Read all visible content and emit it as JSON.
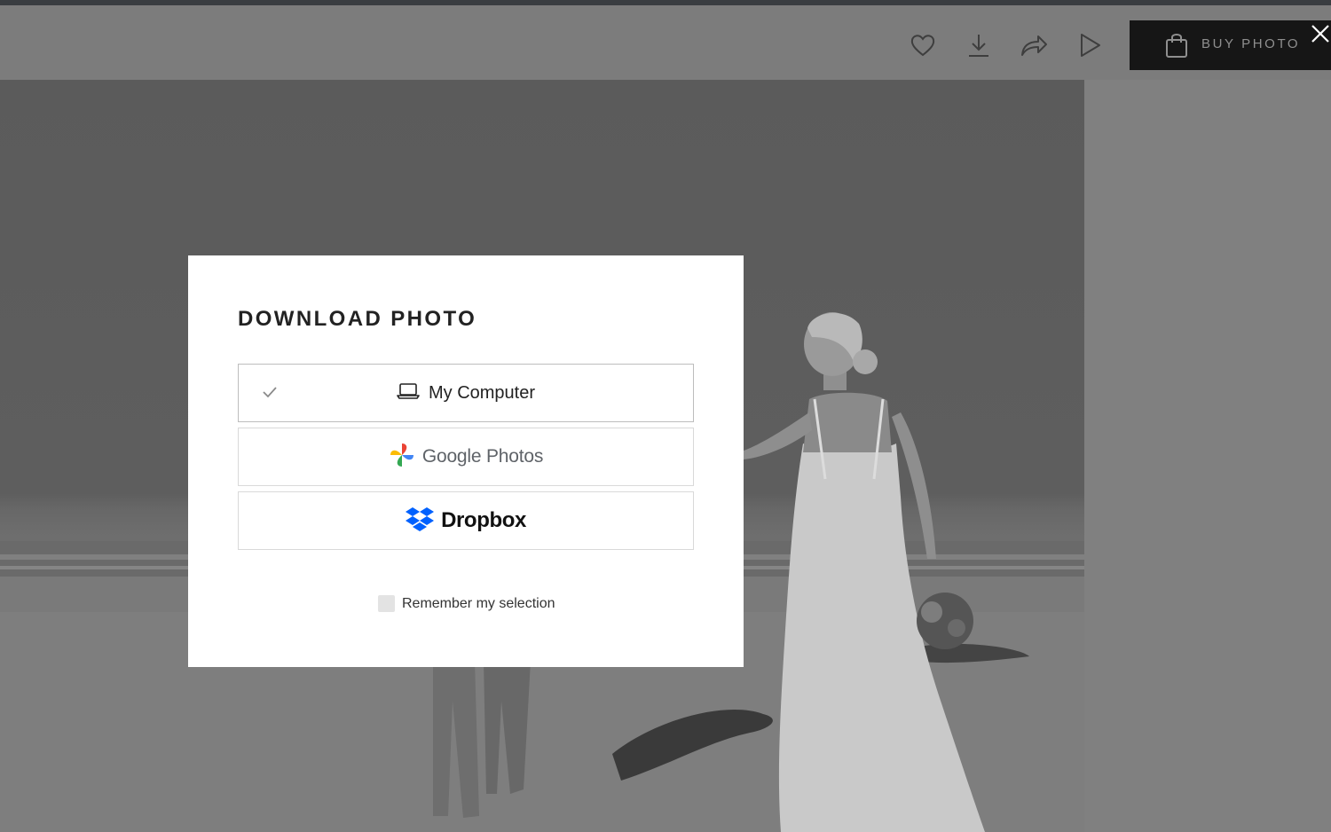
{
  "toolbar": {
    "icons": [
      "heart-icon",
      "download-icon",
      "share-icon",
      "play-icon"
    ],
    "buy_label": "BUY PHOTO",
    "close_icon": "close-icon"
  },
  "photo": {
    "description_icon": "wedding-beach-photo"
  },
  "modal": {
    "title": "DOWNLOAD PHOTO",
    "options": [
      {
        "label": "My Computer",
        "icon": "laptop-icon",
        "selected": true
      },
      {
        "label": "Google Photos",
        "icon": "google-photos-icon",
        "selected": false
      },
      {
        "label": "Dropbox",
        "icon": "dropbox-icon",
        "selected": false
      }
    ],
    "remember_label": "Remember my selection",
    "remember_checked": false
  },
  "colors": {
    "overlay": "#808080",
    "button_dark": "#161616",
    "dropbox_blue": "#0061fe",
    "text_dark": "#222222"
  }
}
